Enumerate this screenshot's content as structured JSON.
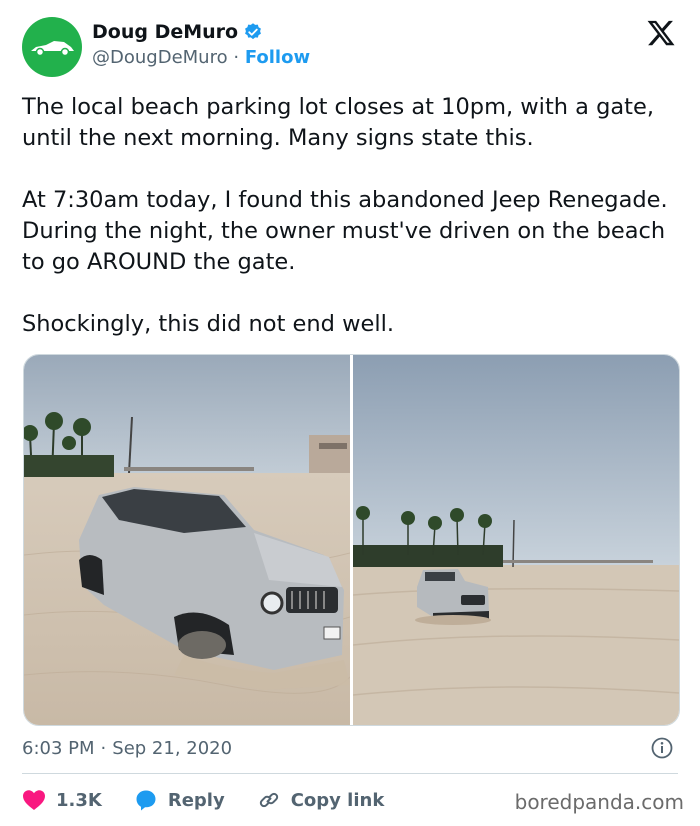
{
  "author": {
    "name": "Doug DeMuro",
    "handle": "@DougDeMuro",
    "separator": "·",
    "follow_label": "Follow",
    "verified_color": "#1d9bf0",
    "avatar_color": "#22b14c"
  },
  "platform_icon": "x-logo-icon",
  "tweet": {
    "text": "The local beach parking lot closes at 10pm, with a gate, until the next morning. Many signs state this.\n\nAt 7:30am today, I found this abandoned Jeep Renegade. During the night, the owner must've driven on the beach to go AROUND the gate.\n\nShockingly, this did not end well."
  },
  "media": {
    "photos": [
      {
        "subject": "silver Jeep Renegade stuck in sand, close-up"
      },
      {
        "subject": "silver Jeep Renegade stuck in sand, wide view"
      }
    ]
  },
  "meta": {
    "time": "6:03 PM",
    "separator": "·",
    "date": "Sep 21, 2020"
  },
  "actions": {
    "likes": "1.3K",
    "reply_label": "Reply",
    "copy_label": "Copy link",
    "like_color": "#f91880",
    "reply_color": "#1d9bf0"
  },
  "watermark": "boredpanda.com"
}
